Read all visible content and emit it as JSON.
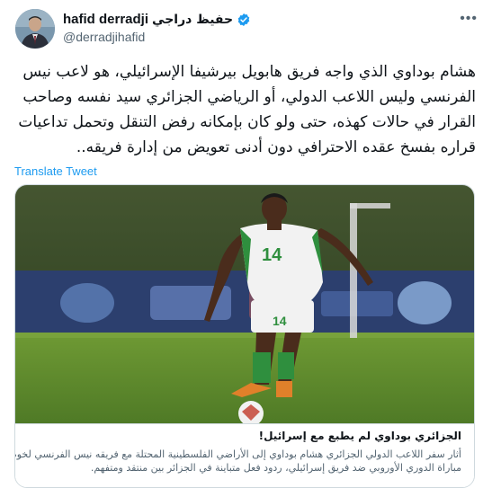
{
  "author": {
    "name_en": "hafid derradji",
    "name_ar": "حفيظ دراجي",
    "handle": "@derradjihafid",
    "verified_icon": "verified-badge-icon",
    "avatar_icon": "avatar-photo"
  },
  "more_icon": "more-options-icon",
  "tweet": {
    "lines": [
      "هشام بوداوي الذي واجه فريق هابويل بيرشيفا الإسرائيلي، هو لاعب نيس",
      "الفرنسي وليس اللاعب الدولي، أو الرياضي الجزائري سيد نفسه وصاحب",
      "القرار في حالات كهذه، حتى ولو كان بإمكانه رفض التنقل وتحمل تداعيات",
      "قراره بفسخ عقده الاحترافي دون أدنى تعويض من إدارة فريقه.."
    ]
  },
  "translate_label": "Translate Tweet",
  "card": {
    "jersey_number": "14",
    "title": "الجزائري بوداوي لم يطبع مع إسرائيل!",
    "description_lines": [
      "أثار سفر اللاعب الدولي الجزائري هشام بوداوي إلى الأراضي الفلسطينية المحتلة مع فريقه نيس الفرنسي لخوض",
      "مباراة الدوري الأوروبي ضد فريق إسرائيلي، ردود فعل متباينة في الجزائر بين منتقد ومتفهم."
    ]
  },
  "colors": {
    "link": "#1d9bf0",
    "verified": "#1d9bf0",
    "text": "#0f1419",
    "secondary": "#536471",
    "pitch": "#5e8a2c"
  }
}
